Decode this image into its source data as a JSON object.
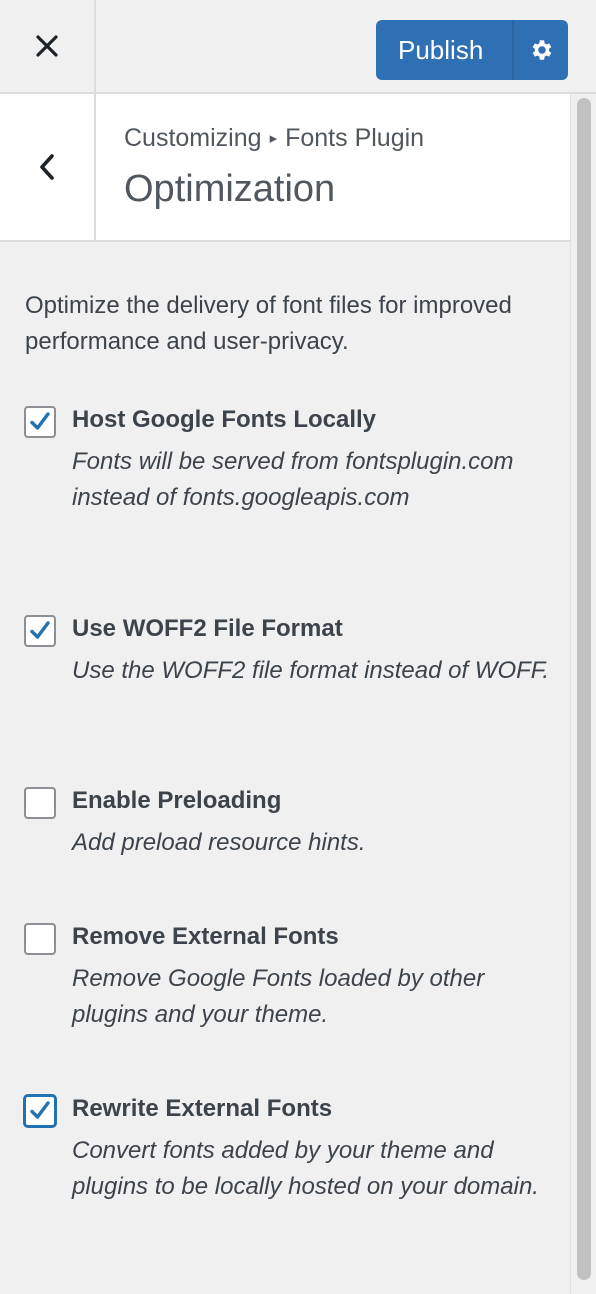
{
  "topbar": {
    "close_icon": "close-icon",
    "publish_label": "Publish",
    "settings_icon": "gear-icon"
  },
  "header": {
    "back_icon": "chevron-left-icon",
    "breadcrumb_parent": "Customizing",
    "breadcrumb_separator": "▸",
    "breadcrumb_child": "Fonts Plugin",
    "title": "Optimization"
  },
  "content": {
    "description": "Optimize the delivery of font files for improved performance and user-privacy.",
    "options": [
      {
        "label": "Host Google Fonts Locally",
        "description": "Fonts will be served from fontsplugin.com instead of fonts.googleapis.com",
        "checked": true
      },
      {
        "label": "Use WOFF2 File Format",
        "description": "Use the WOFF2 file format instead of WOFF.",
        "checked": true
      },
      {
        "label": "Enable Preloading",
        "description": "Add preload resource hints.",
        "checked": false
      },
      {
        "label": "Remove External Fonts",
        "description": "Remove Google Fonts loaded by other plugins and your theme.",
        "checked": false
      },
      {
        "label": "Rewrite External Fonts",
        "description": "Convert fonts added by your theme and plugins to be locally hosted on your domain.",
        "checked": true
      }
    ]
  },
  "colors": {
    "accent": "#2271b1",
    "publish_bg": "#2f6fb3",
    "panel_bg": "#f0f0f1"
  }
}
